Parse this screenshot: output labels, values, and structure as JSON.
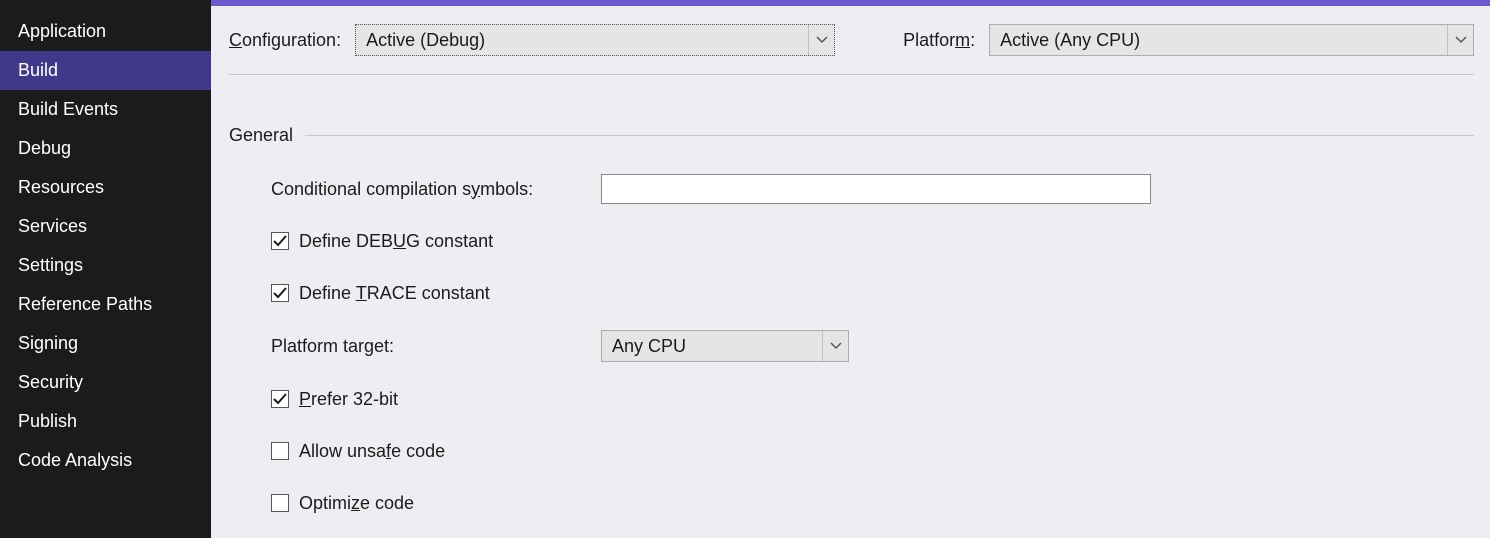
{
  "sidebar": {
    "items": [
      {
        "label": "Application"
      },
      {
        "label": "Build"
      },
      {
        "label": "Build Events"
      },
      {
        "label": "Debug"
      },
      {
        "label": "Resources"
      },
      {
        "label": "Services"
      },
      {
        "label": "Settings"
      },
      {
        "label": "Reference Paths"
      },
      {
        "label": "Signing"
      },
      {
        "label": "Security"
      },
      {
        "label": "Publish"
      },
      {
        "label": "Code Analysis"
      }
    ],
    "active_index": 1
  },
  "toprow": {
    "configuration_label_pre": "C",
    "configuration_label_post": "onfiguration:",
    "configuration_value": "Active (Debug)",
    "platform_label_pre": "Platfor",
    "platform_label_u": "m",
    "platform_label_post": ":",
    "platform_value": "Active (Any CPU)"
  },
  "section": {
    "title": "General"
  },
  "form": {
    "cond_label_pre": "Conditional compilation s",
    "cond_label_u": "y",
    "cond_label_post": "mbols:",
    "cond_value": "",
    "debug_pre": "Define DEB",
    "debug_u": "U",
    "debug_post": "G constant",
    "debug_checked": true,
    "trace_pre": "Define ",
    "trace_u": "T",
    "trace_post": "RACE constant",
    "trace_checked": true,
    "ptarget_label_pre": "Platform tar",
    "ptarget_label_u": "g",
    "ptarget_label_post": "et:",
    "ptarget_value": "Any CPU",
    "prefer32_pre": "",
    "prefer32_u": "P",
    "prefer32_post": "refer 32-bit",
    "prefer32_checked": true,
    "unsafe_pre": "Allow unsa",
    "unsafe_u": "f",
    "unsafe_post": "e code",
    "unsafe_checked": false,
    "optimize_pre": "Optimi",
    "optimize_u": "z",
    "optimize_post": "e code",
    "optimize_checked": false
  }
}
